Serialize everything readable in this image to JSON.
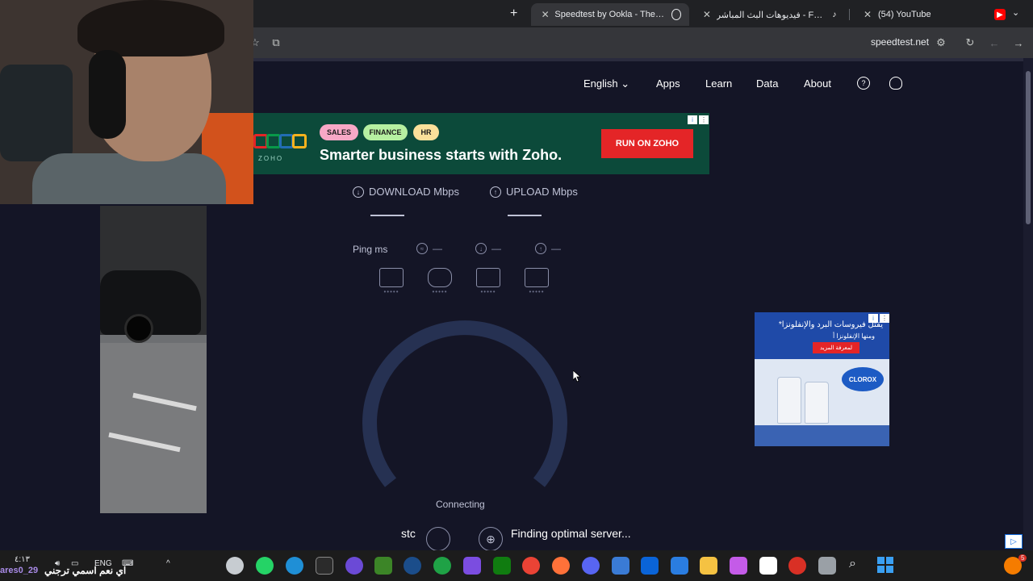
{
  "browser": {
    "tabs": [
      {
        "label": "Speedtest by Ookla - The Global",
        "active": true
      },
      {
        "label": "فيديوهات البث المباشر - Fortnite",
        "active": false
      },
      {
        "label": "(54) YouTube",
        "active": false
      }
    ],
    "url": "speedtest.net"
  },
  "nav": {
    "language": "English",
    "items": [
      "Apps",
      "Learn",
      "Data",
      "About"
    ]
  },
  "zoho_ad": {
    "tags": [
      "SALES",
      "FINANCE",
      "HR"
    ],
    "brand": "ZOHO",
    "headline": "Smarter business starts with Zoho.",
    "cta": "RUN ON ZOHO"
  },
  "metrics": {
    "download_label": "DOWNLOAD Mbps",
    "upload_label": "UPLOAD Mbps",
    "ping_label": "Ping ms",
    "ping_values": [
      "—",
      "—",
      "—"
    ]
  },
  "status": {
    "connecting": "Connecting",
    "isp": "stc",
    "server": "Finding optimal server..."
  },
  "clorox_ad": {
    "headline": "يقتل فيروسات البرد والإنفلونزا*",
    "subline": "ومنها الإنفلونزا أ",
    "cta": "لمعرفة المزيد",
    "brand": "CLOROX"
  },
  "taskbar": {
    "overlay_text": "اي نعم اسمي ترجني",
    "user_text": "ares0_29",
    "lang": "ENG",
    "time": "٤:١٣",
    "notifications": "5"
  },
  "colors": {
    "page_bg": "#141526",
    "gauge": "#2a3654",
    "accent_cta": "#e42527"
  }
}
